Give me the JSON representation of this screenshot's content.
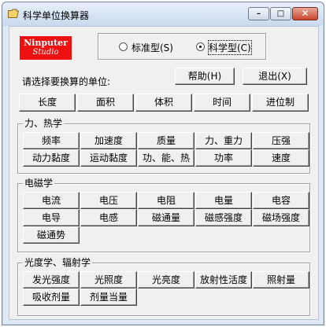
{
  "window": {
    "title": "科学单位换算器",
    "controls": {
      "minimize": "–",
      "maximize": "□",
      "close": "✕"
    }
  },
  "logo": {
    "line1": "Ninputer",
    "line2": "Studio"
  },
  "mode": {
    "options": [
      {
        "label": "标准型(S)",
        "selected": false
      },
      {
        "label": "科学型(C)",
        "selected": true
      }
    ]
  },
  "prompt": "请选择要换算的单位:",
  "buttons": {
    "help": "帮助(H)",
    "exit": "退出(X)"
  },
  "top_units": [
    "长度",
    "面积",
    "体积",
    "时间",
    "进位制"
  ],
  "groups": [
    {
      "title": "力、热学",
      "rows": [
        [
          "频率",
          "加速度",
          "质量",
          "力、重力",
          "压强"
        ],
        [
          "动力黏度",
          "运动黏度",
          "功、能、热",
          "功率",
          "速度"
        ]
      ]
    },
    {
      "title": "电磁学",
      "rows": [
        [
          "电流",
          "电压",
          "电阻",
          "电量",
          "电容"
        ],
        [
          "电导",
          "电感",
          "磁通量",
          "磁感强度",
          "磁场强度"
        ],
        [
          "磁通势"
        ]
      ]
    },
    {
      "title": "光度学、辐射学",
      "rows": [
        [
          "发光强度",
          "光照度",
          "光亮度",
          "放射性活度",
          "照射量"
        ],
        [
          "吸收剂量",
          "剂量当量"
        ]
      ]
    }
  ],
  "colors": {
    "logo_bg": "#ee1111",
    "face": "#f0f0f0",
    "close_button": "#c8442d"
  }
}
